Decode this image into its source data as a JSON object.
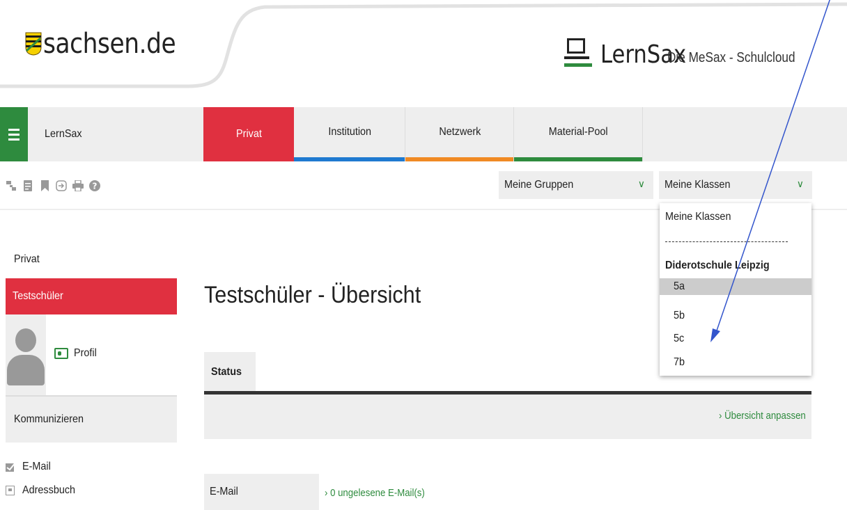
{
  "header": {
    "sachsen_logo_text": "sachsen.de",
    "brand_title": "LernSax",
    "brand_subtitle": "Die MeSax - Schulcloud"
  },
  "nav": {
    "app_name": "LernSax",
    "tabs": [
      {
        "label": "Privat",
        "color": "#e03040",
        "active": true
      },
      {
        "label": "Institution",
        "color": "#1f7ad0"
      },
      {
        "label": "Netzwerk",
        "color": "#f08a24"
      },
      {
        "label": "Material-Pool",
        "color": "#2e8b3e"
      }
    ]
  },
  "toolbar": {
    "icons": [
      "sitemap-icon",
      "notes-icon",
      "bookmark-icon",
      "login-icon",
      "print-icon",
      "help-icon"
    ],
    "groups_select": "Meine Gruppen",
    "classes_select": "Meine Klassen"
  },
  "dropdown": {
    "items": [
      {
        "label": "Meine Klassen"
      },
      {
        "label": "Diderotschule Leipzig"
      },
      {
        "label": "5a",
        "selected": true
      },
      {
        "label": "5b"
      },
      {
        "label": "5c"
      },
      {
        "label": "7b"
      }
    ]
  },
  "sidebar": {
    "section_title": "Privat",
    "user_name": "Testschüler",
    "profile_label": "Profil",
    "kommunizieren_label": "Kommunizieren",
    "links": [
      {
        "label": "E-Mail",
        "icon": "mail-check-icon"
      },
      {
        "label": "Adressbuch",
        "icon": "addressbook-icon"
      }
    ]
  },
  "main": {
    "title": "Testschüler - Übersicht",
    "status_tab": "Status",
    "customize_link": "Übersicht anpassen",
    "email_label": "E-Mail",
    "email_value": "0 ungelesene E-Mail(s)"
  },
  "colors": {
    "accent_green": "#2e8b3e",
    "accent_red": "#e03040",
    "panel_grey": "#eeeeee",
    "annotation_arrow": "#3355cc"
  }
}
